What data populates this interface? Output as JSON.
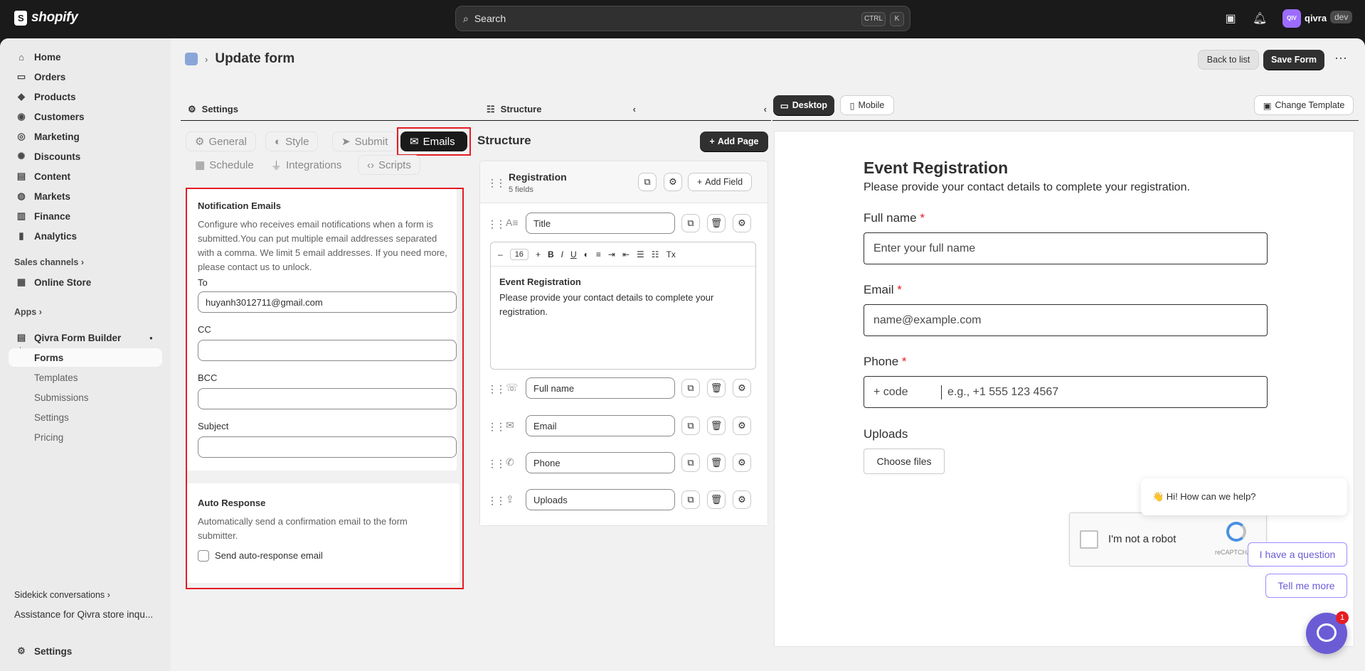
{
  "topbar": {
    "brand": "shopify",
    "search_placeholder": "Search",
    "kbd_ctrl": "CTRL",
    "kbd_k": "K",
    "avatar_initials": "QIV",
    "store": "qivra",
    "env_badge": "dev"
  },
  "sidebar": {
    "items": [
      "Home",
      "Orders",
      "Products",
      "Customers",
      "Marketing",
      "Discounts",
      "Content",
      "Markets",
      "Finance",
      "Analytics"
    ],
    "sales_channels": "Sales channels",
    "online_store": "Online Store",
    "apps": "Apps",
    "app_name": "Qivra Form Builder",
    "app_sub": [
      "Forms",
      "Templates",
      "Submissions",
      "Settings",
      "Pricing"
    ],
    "sidekick": "Sidekick conversations",
    "sidekick_item": "Assistance for Qivra store inqu...",
    "settings": "Settings"
  },
  "page": {
    "title": "Update form",
    "back_label": "Back to list",
    "save_label": "Save Form",
    "more": "⋯"
  },
  "settings": {
    "header": "Settings",
    "tabs": [
      "General",
      "Style",
      "Submit",
      "Emails",
      "Schedule",
      "Integrations",
      "Scripts"
    ],
    "notification": {
      "title": "Notification Emails",
      "desc": "Configure who receives email notifications when a form is submitted.You can put multiple email addresses separated with a comma. We limit 5 email addresses. If you need more, please contact us to unlock.",
      "to_label": "To",
      "to_value": "huyanh3012711@gmail.com",
      "cc_label": "CC",
      "bcc_label": "BCC",
      "subject_label": "Subject"
    },
    "auto": {
      "title": "Auto Response",
      "desc": "Automatically send a confirmation email to the form submitter.",
      "checkbox": "Send auto-response email"
    }
  },
  "structure": {
    "header": "Structure",
    "title": "Structure",
    "add_page": "Add Page",
    "section": "Registration",
    "count": "5 fields",
    "add_field": "Add Field",
    "fields": [
      "Title",
      "Full name",
      "Email",
      "Phone",
      "Uploads"
    ],
    "editor": {
      "font_size": "16",
      "heading": "Event Registration",
      "body": "Please provide your contact details to complete your registration."
    }
  },
  "preview": {
    "desktop": "Desktop",
    "mobile": "Mobile",
    "change_template": "Change Template",
    "title": "Event Registration",
    "subtitle": "Please provide your contact details to complete your registration.",
    "fullname_label": "Full name",
    "fullname_ph": "Enter your full name",
    "email_label": "Email",
    "email_ph": "name@example.com",
    "phone_label": "Phone",
    "phone_code": "+ code",
    "phone_ph": "e.g., +1 555 123 4567",
    "req": "*",
    "uploads_label": "Uploads",
    "choose_files": "Choose files",
    "captcha": "I'm not a robot",
    "recaptcha": "reCAPTCHA",
    "chat_greeting": "👋 Hi! How can we help?",
    "chat_q1": "I have a question",
    "chat_q2": "Tell me more",
    "chat_badge": "1"
  }
}
